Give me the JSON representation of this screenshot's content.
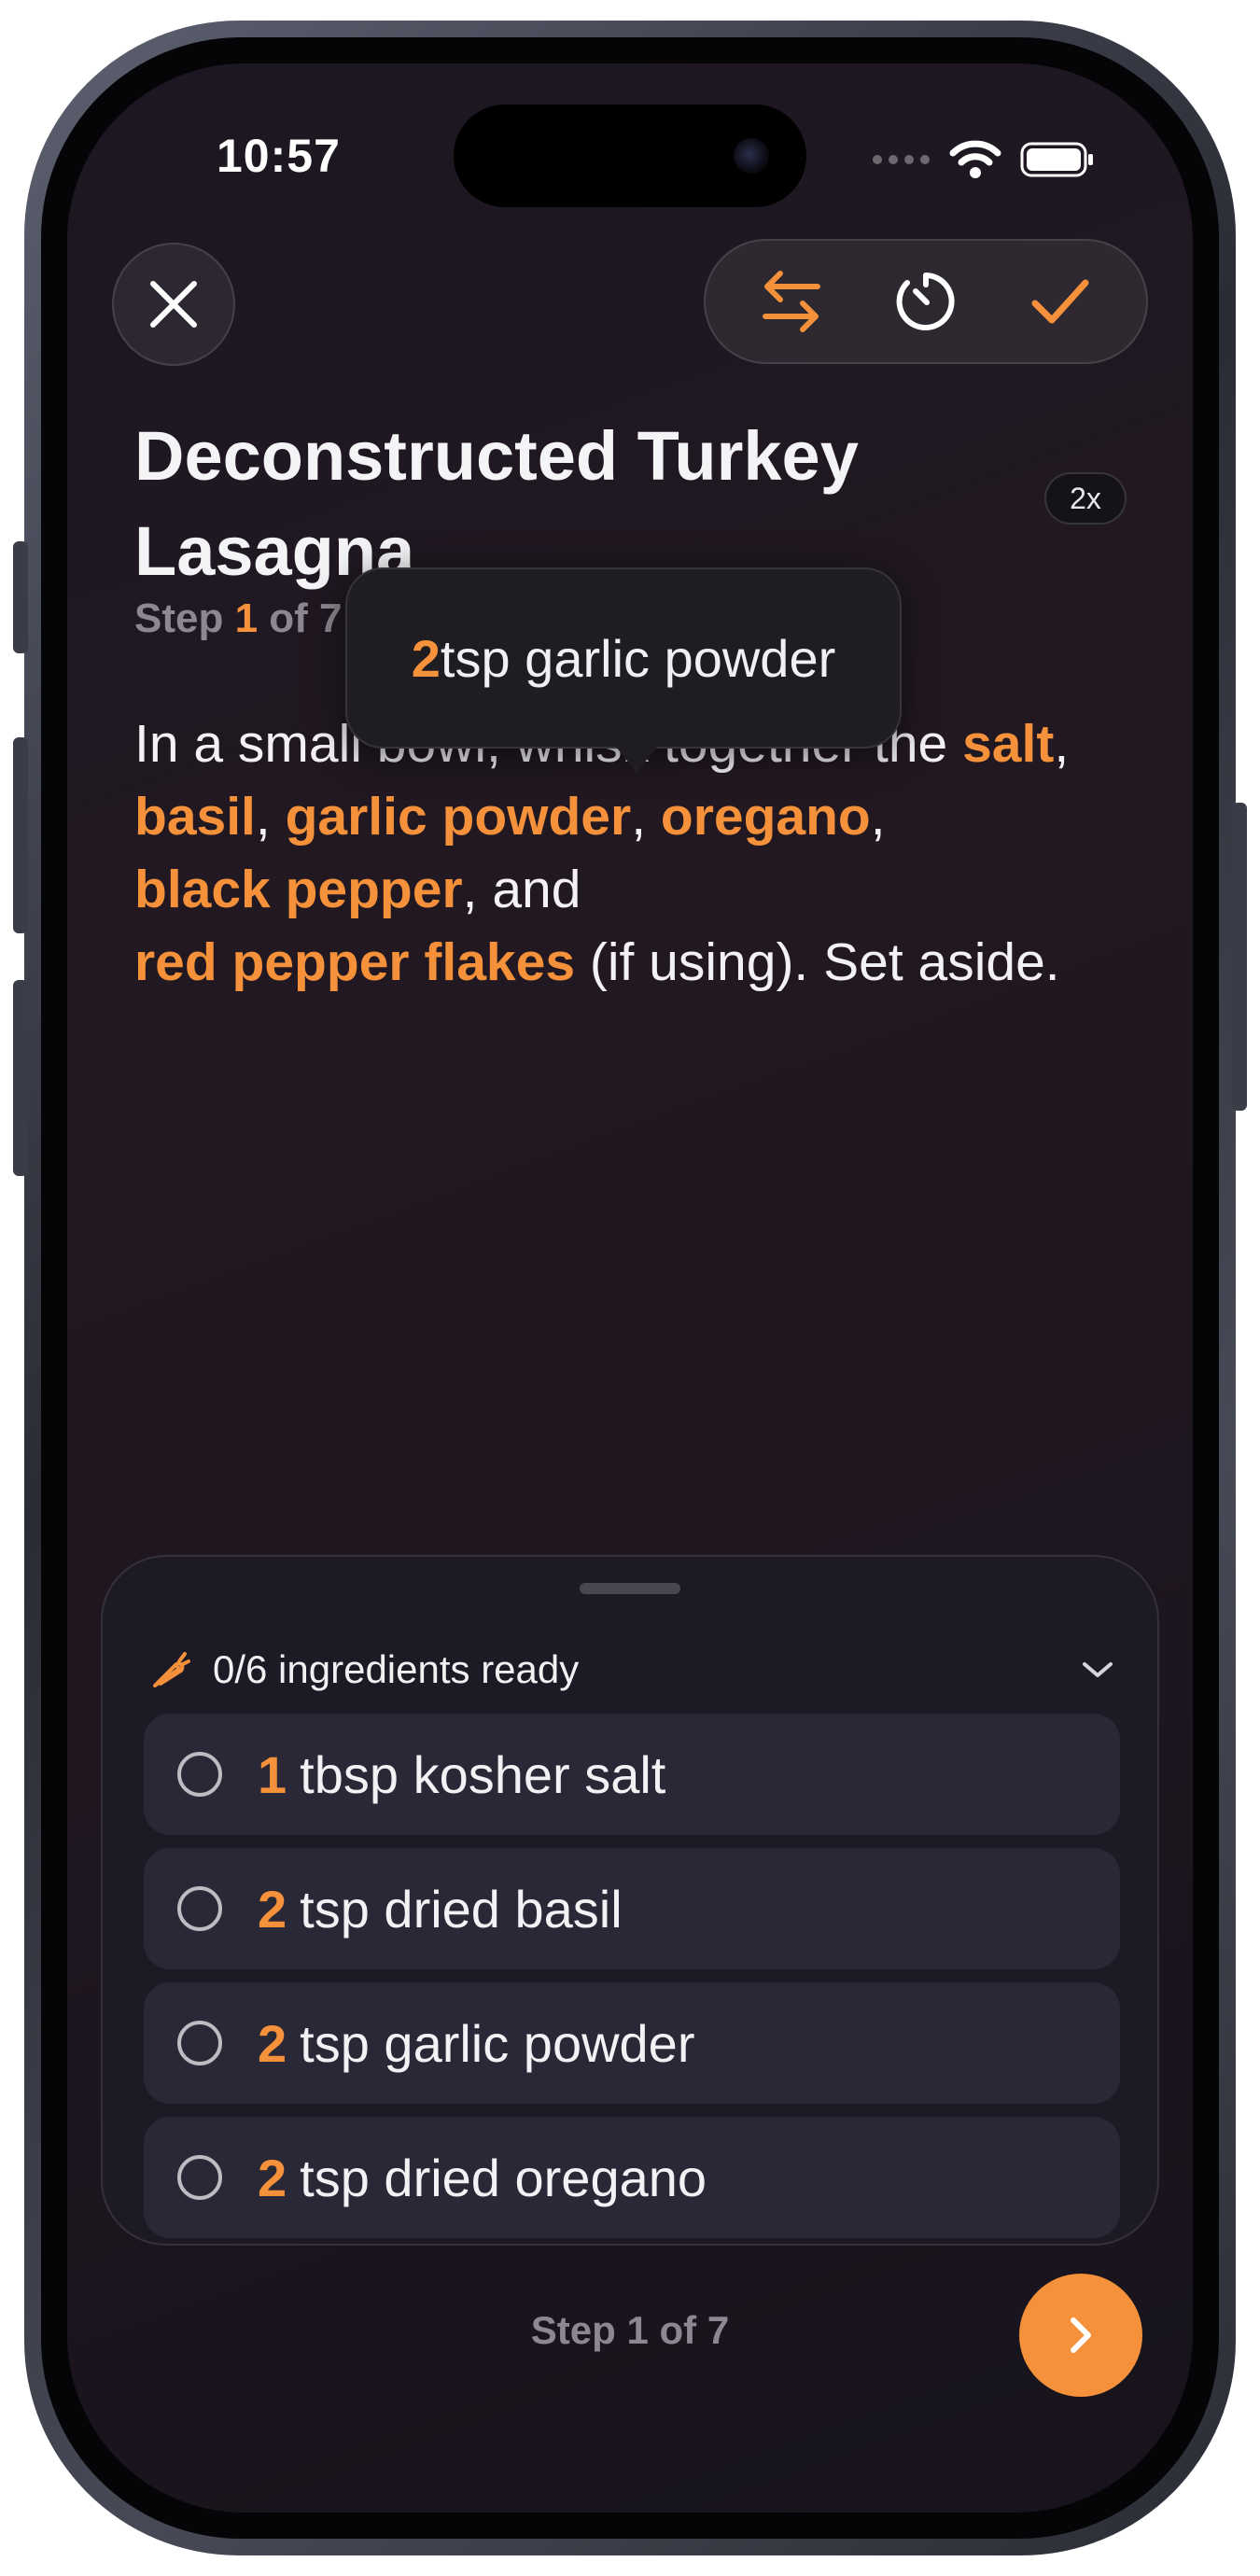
{
  "status_bar": {
    "time": "10:57"
  },
  "toolbar": {
    "close_icon": "close-icon",
    "swap_icon": "swap-arrows-icon",
    "timer_icon": "timer-icon",
    "check_icon": "checkmark-icon"
  },
  "recipe": {
    "title": "Deconstructed Turkey Lasagna",
    "multiplier": "2x",
    "step": {
      "prefix": "Step ",
      "current": "1",
      "of_text": " of ",
      "total": "7"
    }
  },
  "instruction": {
    "parts": {
      "p1": "In a small bowl, whisk together the ",
      "salt": "salt",
      "sep1": ", ",
      "basil": "basil",
      "sep2": ", ",
      "garlic": "garlic powder",
      "sep3": ", ",
      "oregano": "oregano",
      "sep4": ", ",
      "pepper": "black pepper",
      "sep5": ", and ",
      "flakes": "red pepper flakes",
      "tail": " (if using). Set aside."
    }
  },
  "tooltip": {
    "qty": "2",
    "text": " tsp garlic powder"
  },
  "ingredients": {
    "header": "0/6 ingredients ready",
    "items": [
      {
        "qty": "1",
        "text": "tbsp kosher salt"
      },
      {
        "qty": "2",
        "text": "tsp dried basil"
      },
      {
        "qty": "2",
        "text": "tsp garlic powder"
      },
      {
        "qty": "2",
        "text": "tsp dried oregano"
      }
    ]
  },
  "footer": {
    "step_label": "Step 1 of 7"
  },
  "colors": {
    "accent": "#f4913a",
    "background": "#1f1620"
  }
}
